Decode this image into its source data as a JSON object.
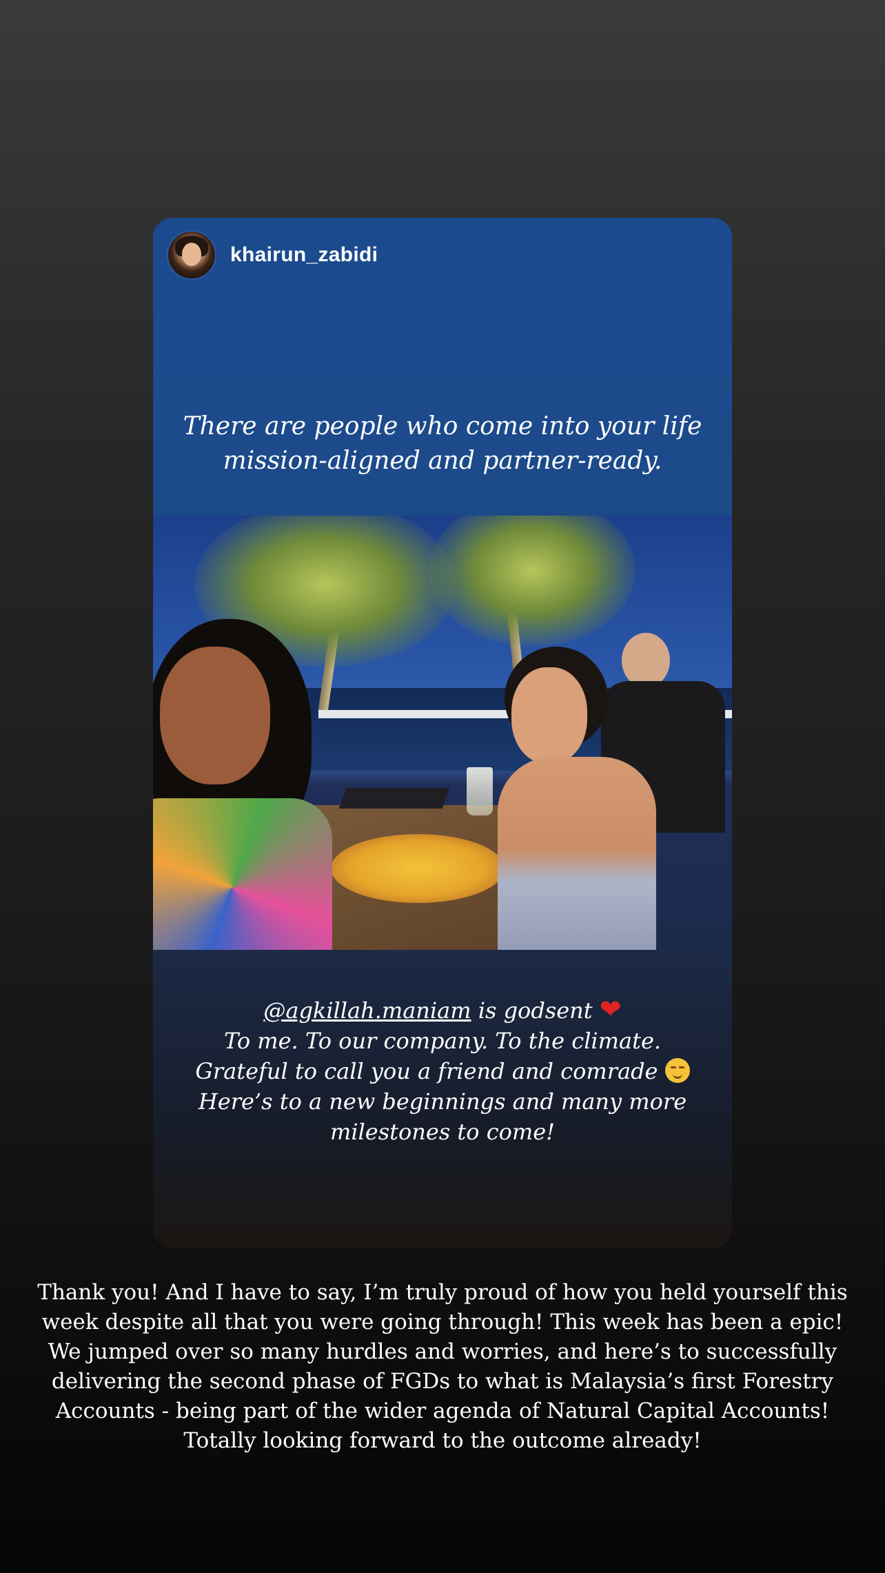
{
  "story": {
    "username": "khairun_zabidi",
    "top_quote_line1": "There are people who come into your life",
    "top_quote_line2": "mission-aligned and partner-ready.",
    "bottom": {
      "mention": "@agkillah.maniam",
      "line1_rest": " is godsent ",
      "line2": "To me. To our company. To the climate.",
      "line3": "Grateful to call you a friend and comrade ",
      "line4": "Here’s to a new beginnings and many more",
      "line5": "milestones to come!"
    },
    "icons": {
      "heart": "heart-icon",
      "smile": "smiling-face-icon",
      "avatar": "profile-avatar"
    },
    "colors": {
      "card_blue": "#1b4a8f",
      "card_dark": "#1c2a46",
      "heart": "#e02424"
    }
  },
  "reply": {
    "line1": "Thank you! And I have to say, I’m truly proud of how you held yourself this",
    "line2": "week despite all that you were going through! This week has been a epic!",
    "line3": "We jumped over so many hurdles and worries, and here’s to successfully",
    "line4": "delivering the second phase of FGDs to what is Malaysia’s first Forestry",
    "line5": "Accounts - being part of the wider agenda of Natural Capital Accounts!",
    "line6": "Totally looking forward to the outcome already!"
  }
}
